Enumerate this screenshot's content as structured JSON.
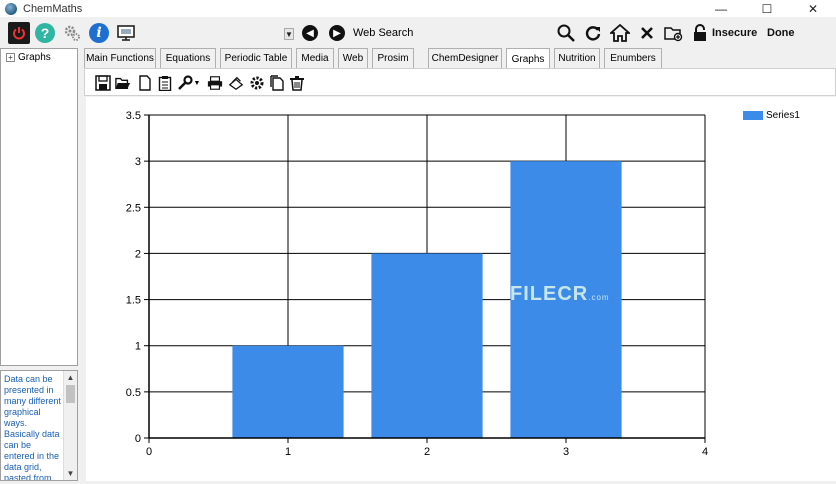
{
  "window": {
    "title": "ChemMaths",
    "controls": {
      "minimize": "—",
      "maximize": "☐",
      "close": "✕"
    }
  },
  "toolbar": {
    "web_search_label": "Web Search",
    "insecure_label": "Insecure",
    "done_label": "Done",
    "icons": [
      "power-icon",
      "help-icon",
      "settings-gears-icon",
      "info-icon",
      "screen-icon",
      "back-icon",
      "forward-icon",
      "search-icon",
      "refresh-icon",
      "home-icon",
      "stop-icon",
      "add-folder-icon",
      "lock-icon"
    ]
  },
  "tree": {
    "items": [
      {
        "expander": "+",
        "label": "Graphs"
      }
    ]
  },
  "description": {
    "text": "Data can be presented in many different graphical ways. Basically data can be entered in the data grid, pasted from"
  },
  "tabs": [
    {
      "label": "Main Functions",
      "active": false
    },
    {
      "label": "Equations",
      "active": false
    },
    {
      "label": "Periodic Table",
      "active": false
    },
    {
      "label": "Media",
      "active": false
    },
    {
      "label": "Web",
      "active": false
    },
    {
      "label": "Prosim",
      "active": false
    },
    {
      "label": "ChemDesigner",
      "active": false
    },
    {
      "label": "Graphs",
      "active": true
    },
    {
      "label": "Nutrition",
      "active": false
    },
    {
      "label": "Enumbers",
      "active": false
    }
  ],
  "graph_toolbar": {
    "icons": [
      "save-icon",
      "open-folder-icon",
      "new-document-icon",
      "clipboard-icon",
      "wrench-icon",
      "print-icon",
      "print-preview-icon",
      "settings-icon",
      "copy-icon",
      "delete-icon"
    ]
  },
  "watermark": {
    "text": "FILECR",
    "suffix": ".com"
  },
  "colors": {
    "bar": "#3d8be8",
    "grid": "#000000"
  },
  "chart_data": {
    "type": "bar",
    "x": [
      1,
      2,
      3
    ],
    "values": [
      1,
      2,
      3
    ],
    "series": [
      {
        "name": "Series1",
        "values": [
          1,
          2,
          3
        ]
      }
    ],
    "xlim": [
      0,
      4
    ],
    "ylim": [
      0,
      3.5
    ],
    "xticks": [
      "0",
      "1",
      "2",
      "3",
      "4"
    ],
    "yticks": [
      "0",
      "0.5",
      "1",
      "1.5",
      "2",
      "2.5",
      "3",
      "3.5"
    ],
    "grid": true,
    "legend": "top-right"
  }
}
